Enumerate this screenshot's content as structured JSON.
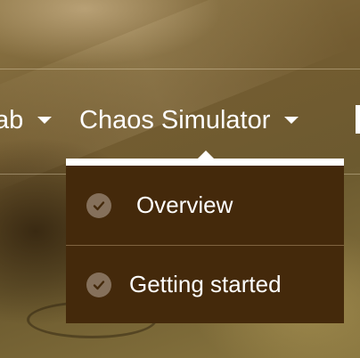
{
  "nav": {
    "items": [
      {
        "label": "ab"
      },
      {
        "label": "Chaos Simulator"
      }
    ]
  },
  "dropdown": {
    "items": [
      {
        "label": "Overview",
        "icon": "check-circle-icon"
      },
      {
        "label": "Getting started",
        "icon": "check-circle-icon"
      }
    ]
  },
  "colors": {
    "dropdown_bg": "#44290b",
    "check_icon_bg": "#85705b",
    "check_mark": "#44290b",
    "text": "#ffffff"
  }
}
